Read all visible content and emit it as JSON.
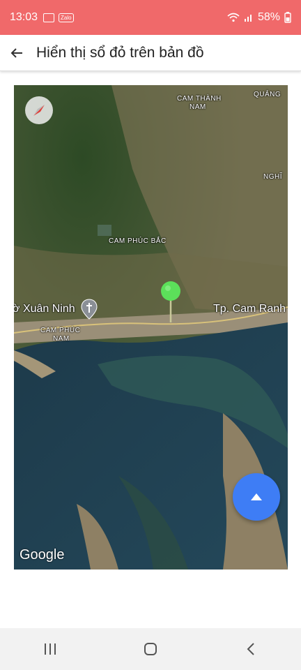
{
  "status_bar": {
    "time": "13:03",
    "zalo_label": "Zalo",
    "battery": "58%"
  },
  "app_bar": {
    "title": "Hiển thị sổ đỏ trên bản đồ"
  },
  "map": {
    "labels": {
      "cam_thanh_nam_1": "CAM THÀNH",
      "cam_thanh_nam_2": "NAM",
      "quang": "QUẢNG",
      "nghi": "NGHĨ",
      "cam_phuc_bac": "CAM PHÚC BẮC",
      "xuan_ninh": "ờ Xuân Ninh",
      "cam_ranh": "Tp. Cam Ranh",
      "cam_phuc_nam_1": "CAM PHÚC",
      "cam_phuc_nam_2": "NAM"
    },
    "attribution": "Google"
  }
}
